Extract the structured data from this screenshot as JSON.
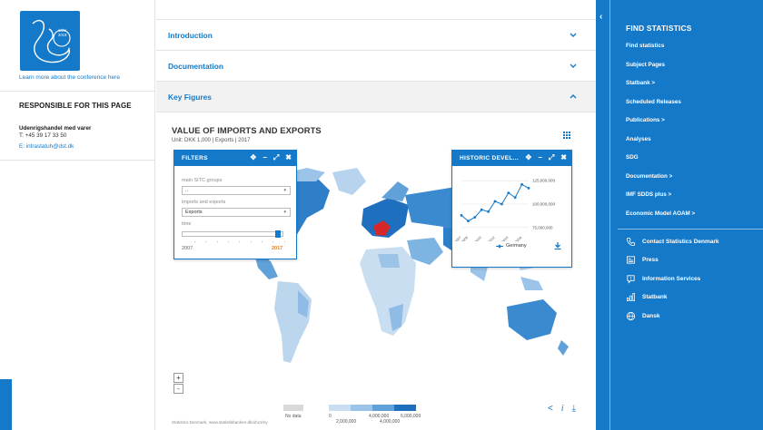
{
  "left": {
    "logo_caption_1": "aalor",
    "logo_caption_2": "2019",
    "conference_link": "Learn more about the conference here",
    "responsible_title": "RESPONSIBLE FOR THIS PAGE",
    "contact_name": "Udenrigshandel med varer",
    "contact_phone": "T: +45 39 17 33 50",
    "contact_email": "E: intrastatuh@dst.dk"
  },
  "accordion": [
    {
      "label": "Introduction",
      "open": false
    },
    {
      "label": "Documentation",
      "open": false
    },
    {
      "label": "Key Figures",
      "open": true
    }
  ],
  "viz": {
    "title": "VALUE OF IMPORTS AND EXPORTS",
    "subtitle": "Unit: DKK 1,000 | Exports | 2017",
    "source": "Statistics Denmark, www.statistikbanken.dk/uhc2/ny"
  },
  "filters": {
    "title": "FILTERS",
    "group_label": "main SITC groups",
    "group_value": "..",
    "flow_label": "imports and exports",
    "flow_value": "Exports",
    "time_label": "time",
    "time_min": "2007",
    "time_max": "2017",
    "time_ticks": "' ' ' ' ' ' ' ' '"
  },
  "historic": {
    "title": "HISTORIC DEVEL...",
    "y_ticks": [
      "125,000,000",
      "100,000,000",
      "75,000,000"
    ],
    "legend": "Germany"
  },
  "chart_data": {
    "type": "line",
    "title": "HISTORIC DEVEL...",
    "x": [
      "2007",
      "2008",
      "2009",
      "2010",
      "2011",
      "2012",
      "2013",
      "2014",
      "2015",
      "2016",
      "2017"
    ],
    "series": [
      {
        "name": "Germany",
        "values": [
          88000000,
          82000000,
          86000000,
          94000000,
          92000000,
          103000000,
          100000000,
          112000000,
          107000000,
          121000000,
          117000000
        ]
      }
    ],
    "y_ticks": [
      "125,000,000",
      "100,000,000",
      "75,000,000"
    ],
    "color": "#1479c9"
  },
  "map_legend": {
    "no_data": "No data",
    "v0": "0",
    "v1": "2,000,000",
    "v2": "4,000,000",
    "v3": "4,000,000",
    "v4": "6,000,000"
  },
  "zoom": {
    "plus": "+",
    "minus": "-"
  },
  "bottom_icons": {
    "share": "<",
    "info": "i",
    "download": "⤓"
  },
  "panel_controls": {
    "move": "✥",
    "minimize": "−",
    "expand": "⤢",
    "close": "✖"
  },
  "right": {
    "collapse": "‹",
    "title": "FIND STATISTICS",
    "items": [
      "Find statistics",
      "Subject Pages",
      "Statbank >",
      "Scheduled Releases",
      "Publications >",
      "Analyses",
      "SDG",
      "Documentation >",
      "IMF SDDS plus >",
      "Economic Model AOAM >"
    ],
    "icon_items": [
      {
        "label": "Contact Statistics Denmark",
        "icon": "phone-icon"
      },
      {
        "label": "Press",
        "icon": "press-icon"
      },
      {
        "label": "Information Services",
        "icon": "chat-icon"
      },
      {
        "label": "Statbank",
        "icon": "bar-chart-icon"
      },
      {
        "label": "Dansk",
        "icon": "globe-icon"
      }
    ]
  },
  "colors": {
    "brand_blue": "#1479c9",
    "map_highlight": "#d62728"
  }
}
